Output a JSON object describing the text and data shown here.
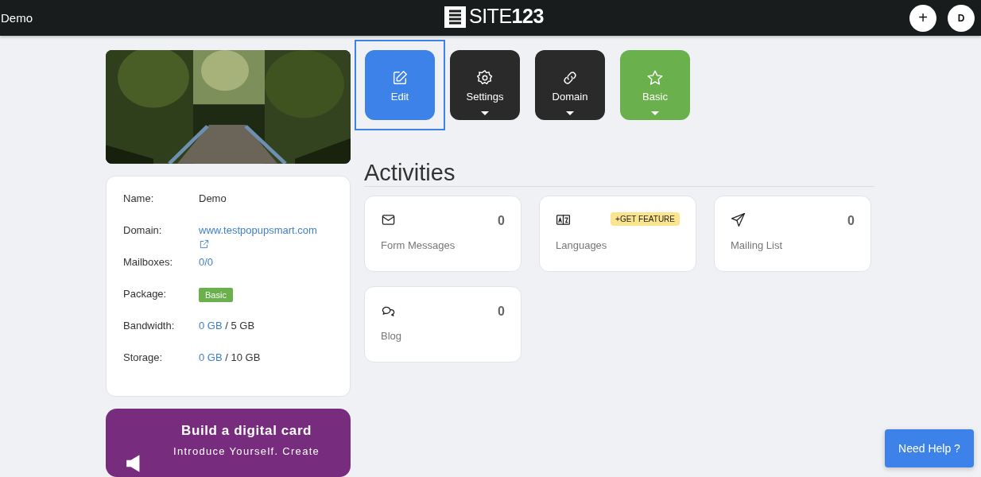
{
  "topbar": {
    "site_name": "Demo",
    "logo": "SITE**123**",
    "buttons": [
      {
        "kind": "add",
        "label": "+"
      },
      {
        "kind": "avatar",
        "label": "D"
      }
    ]
  },
  "info": [
    {
      "label": "Name:",
      "kind": "text",
      "value": "Demo"
    },
    {
      "label": "Domain:",
      "kind": "link",
      "value": "www.testpopupsmart.com"
    },
    {
      "label": "Mailboxes:",
      "kind": "link",
      "value": "0/0"
    },
    {
      "label": "Package:",
      "kind": "badge",
      "value": "Basic"
    },
    {
      "label": "Bandwidth:",
      "kind": "usage",
      "used": "0 GB",
      "total": "/ 5 GB"
    },
    {
      "label": "Storage:",
      "kind": "usage",
      "used": "0 GB",
      "total": "/ 10 GB"
    }
  ],
  "promo": {
    "title": "Build a digital card",
    "text": "Introduce Yourself. Create"
  },
  "actions": [
    {
      "kind": "edit",
      "label": "Edit",
      "selected": true,
      "dropdown": false
    },
    {
      "kind": "settings",
      "label": "Settings",
      "selected": false,
      "dropdown": true
    },
    {
      "kind": "domain",
      "label": "Domain",
      "selected": false,
      "dropdown": true
    },
    {
      "kind": "plan",
      "label": "Basic",
      "selected": false,
      "dropdown": true
    }
  ],
  "activities_title": "Activities",
  "activities": [
    {
      "kind": "mail",
      "label": "Form Messages",
      "count": "0"
    },
    {
      "kind": "languages",
      "label": "Languages",
      "badge": "+GET FEATURE"
    },
    {
      "kind": "send",
      "label": "Mailing List",
      "count": "0"
    },
    {
      "kind": "chat",
      "label": "Blog",
      "count": "0"
    }
  ],
  "help_button": "Need Help ?"
}
